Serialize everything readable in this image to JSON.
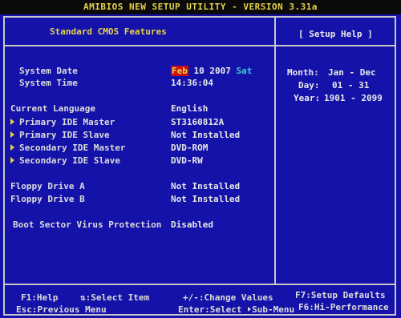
{
  "title": "AMIBIOS NEW SETUP UTILITY - VERSION 3.31a",
  "panel_title": "Standard CMOS Features",
  "help_title": "[ Setup Help ]",
  "system_date": {
    "label": "System Date",
    "month": "Feb",
    "day_year": " 10 2007",
    "weekday": "Sat"
  },
  "system_time": {
    "label": "System Time",
    "value": "14:36:04"
  },
  "current_language": {
    "label": "Current Language",
    "value": "English"
  },
  "ide": [
    {
      "label": "Primary IDE Master",
      "value": "ST3160812A"
    },
    {
      "label": "Primary IDE Slave",
      "value": "Not Installed"
    },
    {
      "label": "Secondary IDE Master",
      "value": "DVD-ROM"
    },
    {
      "label": "Secondary IDE Slave",
      "value": "DVD-RW"
    }
  ],
  "floppy": [
    {
      "label": "Floppy Drive A",
      "value": "Not Installed"
    },
    {
      "label": "Floppy Drive B",
      "value": "Not Installed"
    }
  ],
  "boot_virus": {
    "label": "Boot Sector Virus Protection",
    "value": "Disabled"
  },
  "help": [
    {
      "key": "Month:",
      "value": "Jan - Dec"
    },
    {
      "key": "Day:",
      "value": "01 - 31"
    },
    {
      "key": "Year:",
      "value": "1901 - 2099"
    }
  ],
  "footer": {
    "f1": "F1:Help",
    "select_item": "⇅:Select Item",
    "change_values": "+/-:Change Values",
    "f7": "F7:Setup Defaults",
    "esc": "Esc:Previous Menu",
    "enter_select": "Enter:Select ",
    "sub_menu": "Sub-Menu",
    "f6": "F6:Hi-Performance"
  }
}
